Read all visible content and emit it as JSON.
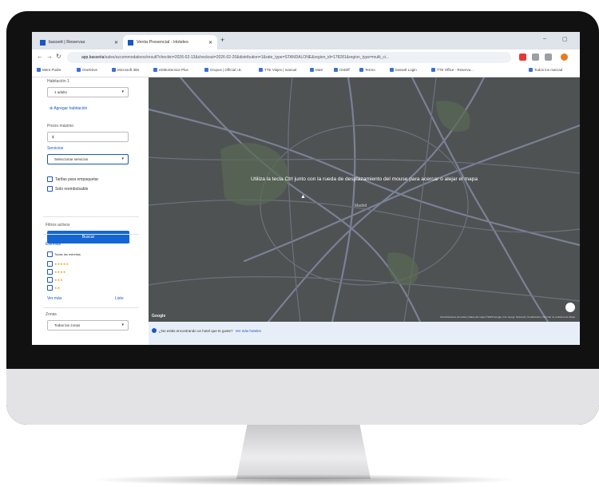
{
  "browser": {
    "tabs": [
      {
        "label": "bassett | Reservas",
        "active": false
      },
      {
        "label": "Venta Presencial - Hoteles",
        "active": true
      }
    ],
    "url_host": "app.bassetia",
    "url_path": "/sales/accommodations/result?checkin=2026-02-13&checkout=2026-02-20&distribution=1&rate_type=STANDALONE&region_id=178281&region_type=multi_ci...",
    "bookmarks": [
      "Mere Pudre",
      "OneDrive",
      "Microsoft 365",
      "eDittoService Plus",
      "Grupos | Official I.E.",
      "TTE Viajes | manual",
      "MaS",
      "OnDiff",
      "Terreo",
      "bassett Login",
      "TTE Office - Reserva...",
      "Todos los marcad"
    ]
  },
  "sidebar": {
    "habitacion_label": "Habitación 1",
    "adults_select": "1 adulto",
    "add_room_link": "Agregar habitación",
    "precio_label": "Precio máximo",
    "precio_value": "$",
    "servicios_label": "Servicios",
    "servicios_select": "Seleccionar servicios",
    "checkbox_tarifas": "Tarifas para empaquetar",
    "checkbox_reembolsable": "Solo reembolsable",
    "buscar_button": "Buscar",
    "filtros_activos": "Filtros activos",
    "estrellas_title": "Estrellas",
    "todas_estrellas": "Todas las estrellas",
    "star_rows": [
      "★★★★★",
      "★★★★",
      "★★★",
      "★★"
    ],
    "ver_mas": "Ver más",
    "limpiar": "Listo",
    "zonas_label": "Zonas",
    "zonas_select": "Todas las zonas"
  },
  "map": {
    "message": "Utiliza la tecla Ctrl junto con la rueda de desplazamiento del mouse para acercar o alejar el mapa",
    "city_label": "Madrid",
    "google": "Google",
    "attribution": "Combinaciones de teclas | Datos del mapa ©2026 Google, Inst. Geogr. Nacional | Condiciones | Informar un problema de Maps"
  },
  "help_bar": {
    "question": "¿No estás encontrando un hotel que te guste?",
    "link": "Ver más hoteles"
  },
  "colors": {
    "primary": "#1466d6",
    "map_bg": "#4f5253",
    "road": "#7a8196"
  }
}
